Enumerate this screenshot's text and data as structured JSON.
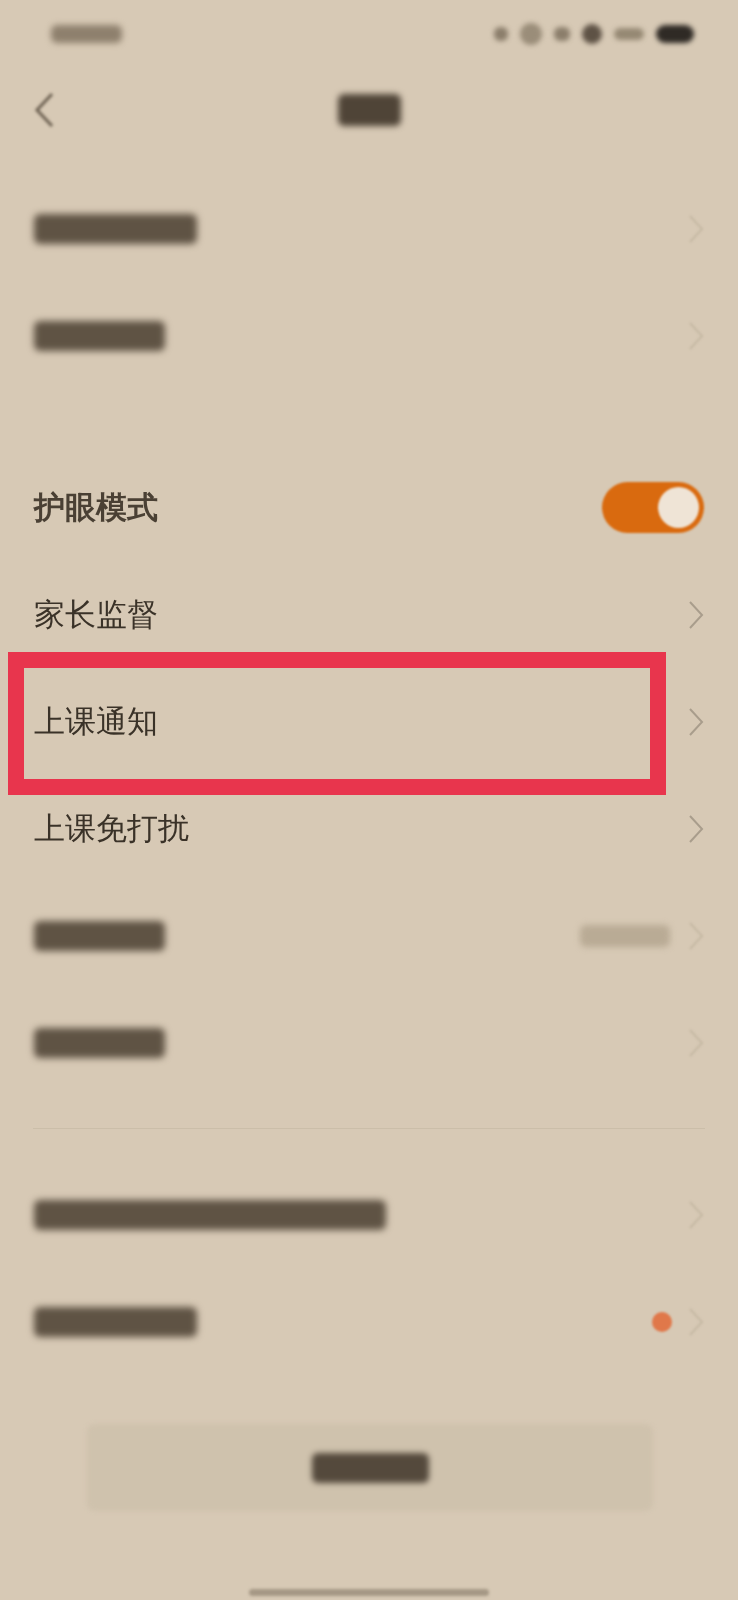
{
  "groups": [
    {
      "rows": [
        {
          "kind": "blurred"
        },
        {
          "kind": "blurred"
        }
      ]
    },
    {
      "rows": [
        {
          "kind": "toggle",
          "label": "护眼模式",
          "on": true
        },
        {
          "kind": "link",
          "label": "家长监督"
        },
        {
          "kind": "link",
          "label": "上课通知",
          "highlighted": true
        },
        {
          "kind": "link",
          "label": "上课免打扰"
        },
        {
          "kind": "blurred",
          "value": true
        },
        {
          "kind": "blurred"
        }
      ]
    },
    {
      "divider_above": true,
      "rows": [
        {
          "kind": "blurred"
        },
        {
          "kind": "blurred",
          "badge": true
        }
      ]
    }
  ]
}
